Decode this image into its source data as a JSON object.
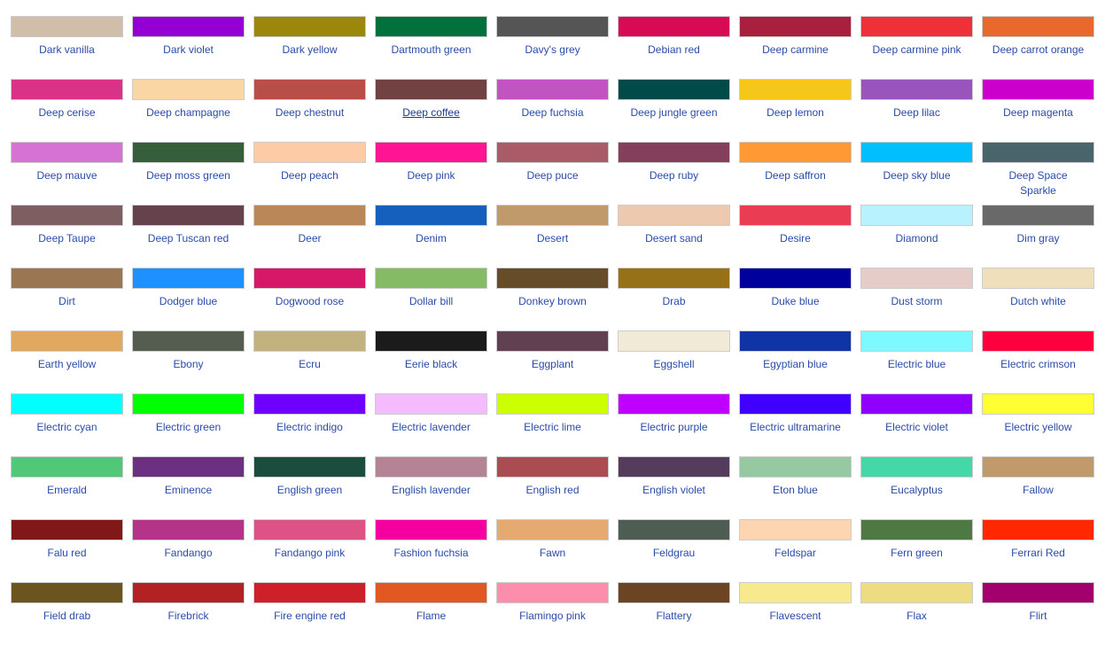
{
  "hovered_index": 12,
  "colors": [
    {
      "name": "Dark vanilla",
      "hex": "#d1bea8"
    },
    {
      "name": "Dark violet",
      "hex": "#9400d3"
    },
    {
      "name": "Dark yellow",
      "hex": "#9b870c"
    },
    {
      "name": "Dartmouth green",
      "hex": "#00703c"
    },
    {
      "name": "Davy's grey",
      "hex": "#555555"
    },
    {
      "name": "Debian red",
      "hex": "#d70a53"
    },
    {
      "name": "Deep carmine",
      "hex": "#a9203e"
    },
    {
      "name": "Deep carmine pink",
      "hex": "#ef3038"
    },
    {
      "name": "Deep carrot orange",
      "hex": "#e9692c"
    },
    {
      "name": "Deep cerise",
      "hex": "#da3287"
    },
    {
      "name": "Deep champagne",
      "hex": "#fad6a5"
    },
    {
      "name": "Deep chestnut",
      "hex": "#b94e48"
    },
    {
      "name": "Deep coffee",
      "hex": "#704241"
    },
    {
      "name": "Deep fuchsia",
      "hex": "#c154c1"
    },
    {
      "name": "Deep jungle green",
      "hex": "#004b49"
    },
    {
      "name": "Deep lemon",
      "hex": "#f5c71a"
    },
    {
      "name": "Deep lilac",
      "hex": "#9955bb"
    },
    {
      "name": "Deep magenta",
      "hex": "#cc00cc"
    },
    {
      "name": "Deep mauve",
      "hex": "#d473d4"
    },
    {
      "name": "Deep moss green",
      "hex": "#355e3b"
    },
    {
      "name": "Deep peach",
      "hex": "#ffcba4"
    },
    {
      "name": "Deep pink",
      "hex": "#ff1493"
    },
    {
      "name": "Deep puce",
      "hex": "#a95c68"
    },
    {
      "name": "Deep ruby",
      "hex": "#843f5b"
    },
    {
      "name": "Deep saffron",
      "hex": "#ff9933"
    },
    {
      "name": "Deep sky blue",
      "hex": "#00bfff"
    },
    {
      "name": "Deep Space Sparkle",
      "hex": "#4a646c"
    },
    {
      "name": "Deep Taupe",
      "hex": "#7e5e60"
    },
    {
      "name": "Deep Tuscan red",
      "hex": "#66424d"
    },
    {
      "name": "Deer",
      "hex": "#ba8759"
    },
    {
      "name": "Denim",
      "hex": "#1560bd"
    },
    {
      "name": "Desert",
      "hex": "#c19a6b"
    },
    {
      "name": "Desert sand",
      "hex": "#edc9af"
    },
    {
      "name": "Desire",
      "hex": "#ea3c53"
    },
    {
      "name": "Diamond",
      "hex": "#b9f2ff"
    },
    {
      "name": "Dim gray",
      "hex": "#696969"
    },
    {
      "name": "Dirt",
      "hex": "#9b7653"
    },
    {
      "name": "Dodger blue",
      "hex": "#1e90ff"
    },
    {
      "name": "Dogwood rose",
      "hex": "#d71868"
    },
    {
      "name": "Dollar bill",
      "hex": "#85bb65"
    },
    {
      "name": "Donkey brown",
      "hex": "#664c28"
    },
    {
      "name": "Drab",
      "hex": "#967117"
    },
    {
      "name": "Duke blue",
      "hex": "#00009c"
    },
    {
      "name": "Dust storm",
      "hex": "#e5ccc9"
    },
    {
      "name": "Dutch white",
      "hex": "#efdfbb"
    },
    {
      "name": "Earth yellow",
      "hex": "#e1a95f"
    },
    {
      "name": "Ebony",
      "hex": "#555d50"
    },
    {
      "name": "Ecru",
      "hex": "#c2b280"
    },
    {
      "name": "Eerie black",
      "hex": "#1b1b1b"
    },
    {
      "name": "Eggplant",
      "hex": "#614051"
    },
    {
      "name": "Eggshell",
      "hex": "#f0ead6"
    },
    {
      "name": "Egyptian blue",
      "hex": "#1034a6"
    },
    {
      "name": "Electric blue",
      "hex": "#7df9ff"
    },
    {
      "name": "Electric crimson",
      "hex": "#ff003f"
    },
    {
      "name": "Electric cyan",
      "hex": "#00ffff"
    },
    {
      "name": "Electric green",
      "hex": "#00ff00"
    },
    {
      "name": "Electric indigo",
      "hex": "#6f00ff"
    },
    {
      "name": "Electric lavender",
      "hex": "#f4bbff"
    },
    {
      "name": "Electric lime",
      "hex": "#ccff00"
    },
    {
      "name": "Electric purple",
      "hex": "#bf00ff"
    },
    {
      "name": "Electric ultramarine",
      "hex": "#3f00ff"
    },
    {
      "name": "Electric violet",
      "hex": "#8f00ff"
    },
    {
      "name": "Electric yellow",
      "hex": "#ffff33"
    },
    {
      "name": "Emerald",
      "hex": "#50c878"
    },
    {
      "name": "Eminence",
      "hex": "#6c3082"
    },
    {
      "name": "English green",
      "hex": "#1b4d3e"
    },
    {
      "name": "English lavender",
      "hex": "#b48395"
    },
    {
      "name": "English red",
      "hex": "#ab4b52"
    },
    {
      "name": "English violet",
      "hex": "#563c5c"
    },
    {
      "name": "Eton blue",
      "hex": "#96c8a2"
    },
    {
      "name": "Eucalyptus",
      "hex": "#44d7a8"
    },
    {
      "name": "Fallow",
      "hex": "#c19a6b"
    },
    {
      "name": "Falu red",
      "hex": "#801818"
    },
    {
      "name": "Fandango",
      "hex": "#b53389"
    },
    {
      "name": "Fandango pink",
      "hex": "#de5285"
    },
    {
      "name": "Fashion fuchsia",
      "hex": "#f400a1"
    },
    {
      "name": "Fawn",
      "hex": "#e5aa70"
    },
    {
      "name": "Feldgrau",
      "hex": "#4d5d53"
    },
    {
      "name": "Feldspar",
      "hex": "#fdd5b1"
    },
    {
      "name": "Fern green",
      "hex": "#4f7942"
    },
    {
      "name": "Ferrari Red",
      "hex": "#ff2800"
    },
    {
      "name": "Field drab",
      "hex": "#6c541e"
    },
    {
      "name": "Firebrick",
      "hex": "#b22222"
    },
    {
      "name": "Fire engine red",
      "hex": "#ce2029"
    },
    {
      "name": "Flame",
      "hex": "#e25822"
    },
    {
      "name": "Flamingo pink",
      "hex": "#fc8eac"
    },
    {
      "name": "Flattery",
      "hex": "#6b4423"
    },
    {
      "name": "Flavescent",
      "hex": "#f7e98e"
    },
    {
      "name": "Flax",
      "hex": "#eedc82"
    },
    {
      "name": "Flirt",
      "hex": "#a2006d"
    }
  ]
}
